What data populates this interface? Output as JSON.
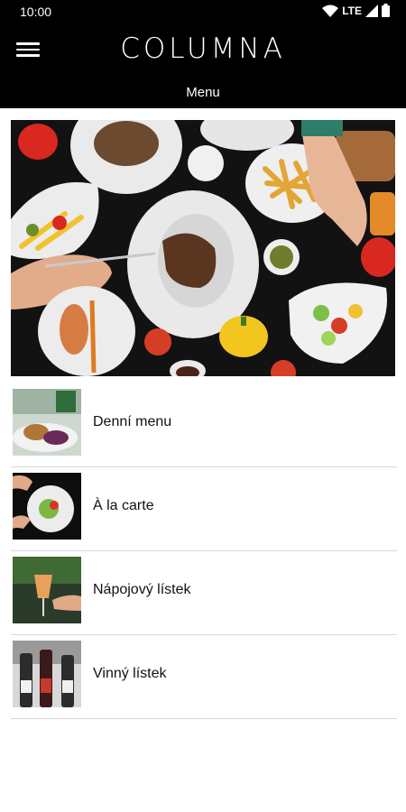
{
  "status_bar": {
    "time": "10:00",
    "network": "LTE"
  },
  "app_bar": {
    "title": "COLUMNA",
    "subtitle": "Menu"
  },
  "menu_items": [
    {
      "label": "Denní menu"
    },
    {
      "label": "À la carte"
    },
    {
      "label": "Nápojový lístek"
    },
    {
      "label": "Vinný lístek"
    }
  ]
}
